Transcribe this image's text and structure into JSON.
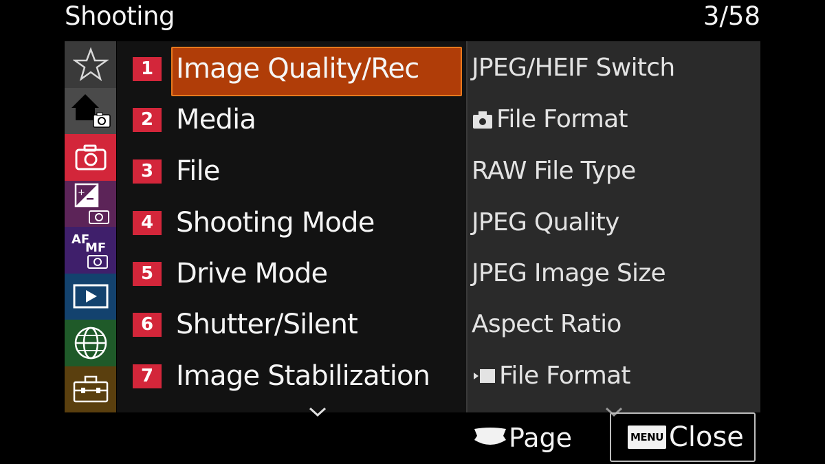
{
  "header": {
    "title": "Shooting",
    "page_indicator": "3/58"
  },
  "sidebar": {
    "tabs": [
      {
        "icon": "star-icon",
        "bg": "#3a3a3a"
      },
      {
        "icon": "home-camera-icon",
        "bg": "#4a4a4a"
      },
      {
        "icon": "camera-icon",
        "bg": "#d3263a"
      },
      {
        "icon": "exposure-camera-icon",
        "bg": "#5c2458"
      },
      {
        "icon": "af-mf-camera-icon",
        "bg": "#3f1f6b"
      },
      {
        "icon": "playback-icon",
        "bg": "#13426e"
      },
      {
        "icon": "globe-icon",
        "bg": "#1f5a29"
      },
      {
        "icon": "toolbox-icon",
        "bg": "#5a3f0e"
      }
    ]
  },
  "menu": {
    "items": [
      {
        "num": "1",
        "label": "Image Quality/Rec",
        "selected": true
      },
      {
        "num": "2",
        "label": "Media"
      },
      {
        "num": "3",
        "label": "File"
      },
      {
        "num": "4",
        "label": "Shooting Mode"
      },
      {
        "num": "5",
        "label": "Drive Mode"
      },
      {
        "num": "6",
        "label": "Shutter/Silent"
      },
      {
        "num": "7",
        "label": "Image Stabilization"
      }
    ]
  },
  "submenu": {
    "items": [
      {
        "label": "JPEG/HEIF Switch"
      },
      {
        "label": "File Format",
        "icon": "still-camera-icon"
      },
      {
        "label": "RAW File Type"
      },
      {
        "label": "JPEG Quality"
      },
      {
        "label": "JPEG Image Size"
      },
      {
        "label": "Aspect Ratio"
      },
      {
        "label": "File Format",
        "icon": "movie-icon"
      }
    ]
  },
  "footer": {
    "page_label": "Page",
    "menu_badge": "MENU",
    "close_label": "Close"
  },
  "colors": {
    "accent_selected": "#b03d08",
    "number_badge": "#d3263a"
  }
}
